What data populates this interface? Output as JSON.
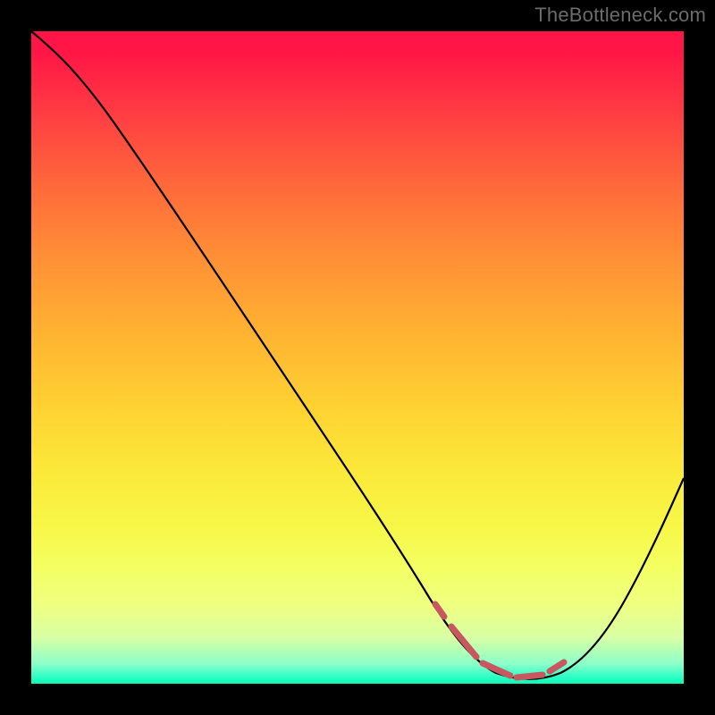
{
  "watermark": "TheBottleneck.com",
  "chart_data": {
    "type": "line",
    "title": "",
    "xlabel": "",
    "ylabel": "",
    "xlim": [
      0,
      100
    ],
    "ylim": [
      0,
      100
    ],
    "grid": false,
    "series": [
      {
        "name": "main-curve",
        "color": "#000000",
        "x": [
          0,
          3,
          7,
          12,
          18,
          24,
          30,
          36,
          42,
          48,
          54,
          58,
          62,
          66,
          70,
          74,
          78,
          82,
          86,
          90,
          94,
          97,
          100
        ],
        "y": [
          100,
          97,
          94,
          89,
          80,
          71,
          62,
          53,
          44,
          35,
          26,
          18,
          11,
          5,
          2,
          1,
          1,
          2,
          5,
          13,
          24,
          34,
          44
        ]
      },
      {
        "name": "bottom-marker-band",
        "color": "#c85b61",
        "x": [
          60,
          63,
          66,
          69,
          72,
          75,
          78,
          81
        ],
        "y": [
          5,
          3,
          2,
          1,
          1,
          1,
          2,
          3
        ]
      }
    ],
    "legend": false,
    "annotations": []
  }
}
